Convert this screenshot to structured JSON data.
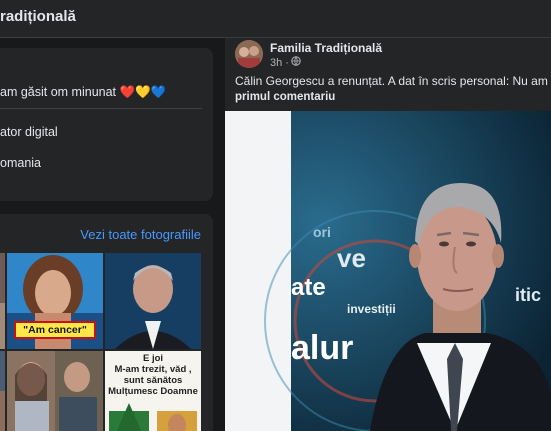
{
  "header": {
    "title": "radițională"
  },
  "intro": {
    "bio": "am găsit om minunat ❤️💛💙",
    "details": [
      "ator digital",
      "omania"
    ]
  },
  "photos": {
    "see_all": "Vezi toate fotografiile",
    "caption_cancer": "\"Am cancer\"",
    "caption_morning": "E joi\nM-am trezit, văd , sunt sănătos\nMulțumesc Doamne"
  },
  "post": {
    "page_name": "Familia Tradițională",
    "time": "3h ·",
    "privacy_icon": "globe-icon",
    "text": "Călin Georgescu a renunțat. A dat în scris personal: Nu am încr",
    "link": "primul comentariu",
    "image_words": [
      "ori",
      "ve",
      "ate",
      "investiții",
      "alur",
      "itic"
    ]
  }
}
